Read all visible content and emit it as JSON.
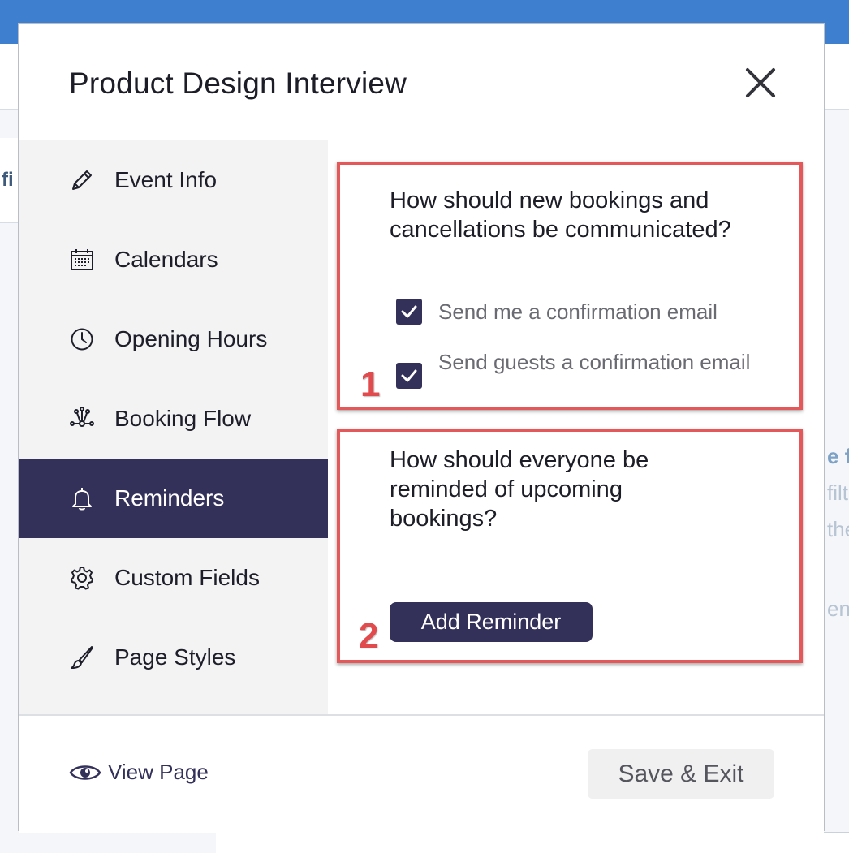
{
  "modal": {
    "title": "Product Design Interview"
  },
  "sidebar": {
    "items": [
      {
        "label": "Event Info",
        "icon": "pencil-icon"
      },
      {
        "label": "Calendars",
        "icon": "calendar-icon"
      },
      {
        "label": "Opening Hours",
        "icon": "clock-icon"
      },
      {
        "label": "Booking Flow",
        "icon": "booking-flow-icon"
      },
      {
        "label": "Reminders",
        "icon": "bell-icon",
        "active": true
      },
      {
        "label": "Custom Fields",
        "icon": "gear-icon"
      },
      {
        "label": "Page Styles",
        "icon": "brush-icon"
      }
    ]
  },
  "reminders": {
    "section1": {
      "callout_number": "1",
      "question": "How should new bookings and cancellations be communicated?",
      "options": [
        {
          "label": "Send me a confirmation email",
          "checked": true
        },
        {
          "label": "Send guests a confirmation email",
          "checked": true
        }
      ]
    },
    "section2": {
      "callout_number": "2",
      "question": "How should everyone be reminded of upcoming bookings?",
      "button_label": "Add Reminder"
    }
  },
  "footer": {
    "view_page_label": "View Page",
    "save_label": "Save & Exit"
  },
  "background": {
    "left_fragment": "fi",
    "right_fragments": [
      "e f",
      "filt",
      "the",
      "ent"
    ]
  },
  "colors": {
    "accent": "#33305a",
    "callout": "#e5585a",
    "topbar": "#3f7fd0"
  }
}
